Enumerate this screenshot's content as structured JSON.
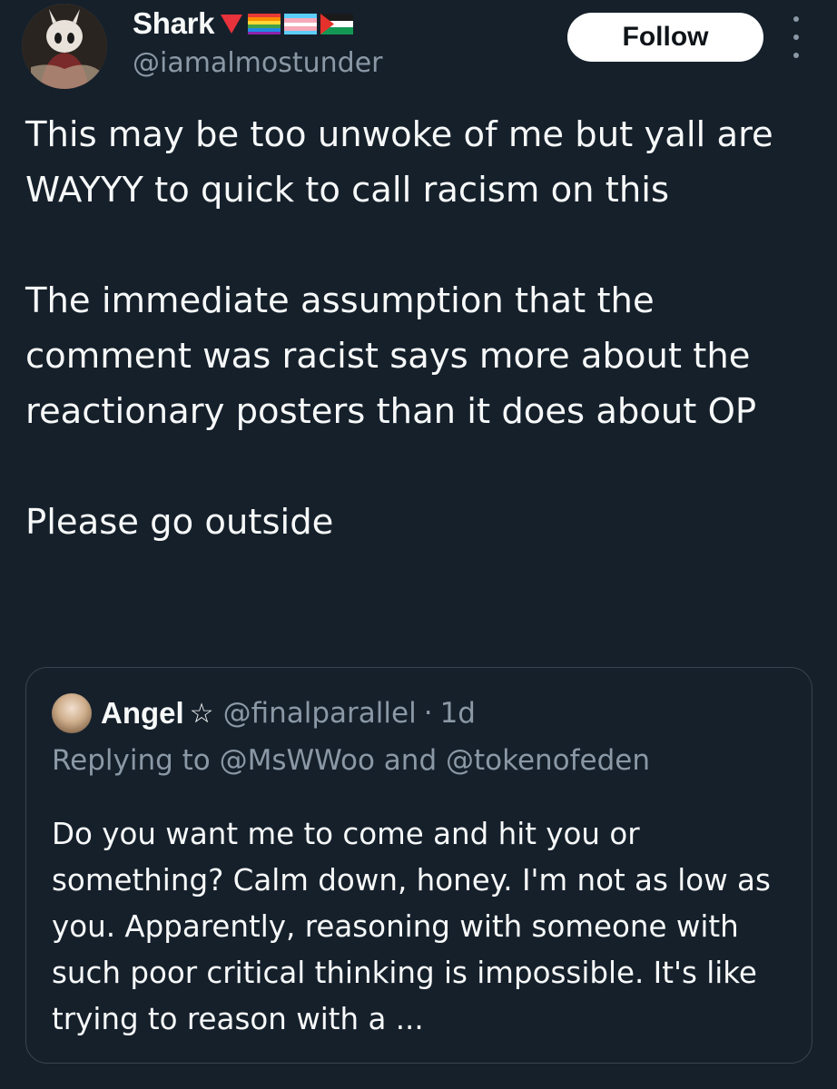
{
  "author": {
    "display_name": "Shark",
    "handle": "@iamalmostunder",
    "avatar_icon": "avatar-image",
    "name_emojis": [
      "red-triangle-icon",
      "rainbow-flag-icon",
      "transgender-flag-icon",
      "palestine-flag-icon"
    ]
  },
  "actions": {
    "follow_label": "Follow",
    "more_icon": "more-vertical-icon"
  },
  "tweet": {
    "paragraphs": [
      "This may be too unwoke of me but yall are WAYYY to quick to call racism on this",
      "The immediate assumption that the comment was racist says more about the reactionary posters than it does about OP",
      "Please go outside"
    ]
  },
  "quote": {
    "display_name": "Angel",
    "star": "☆",
    "handle": "@finalparallel",
    "separator": "·",
    "time": "1d",
    "replying_to": "Replying to @MsWWoo and @tokenofeden",
    "text": "Do you want me to come and hit you or something? Calm down, honey. I'm not as low as you. Apparently, reasoning with someone with such poor critical thinking is impossible. It's like trying to reason with a ..."
  },
  "colors": {
    "background": "#15202b",
    "text_primary": "#f7f9f9",
    "text_secondary": "#8b98a5",
    "border": "#38444d",
    "button_bg": "#ffffff",
    "button_text": "#0f1419"
  }
}
